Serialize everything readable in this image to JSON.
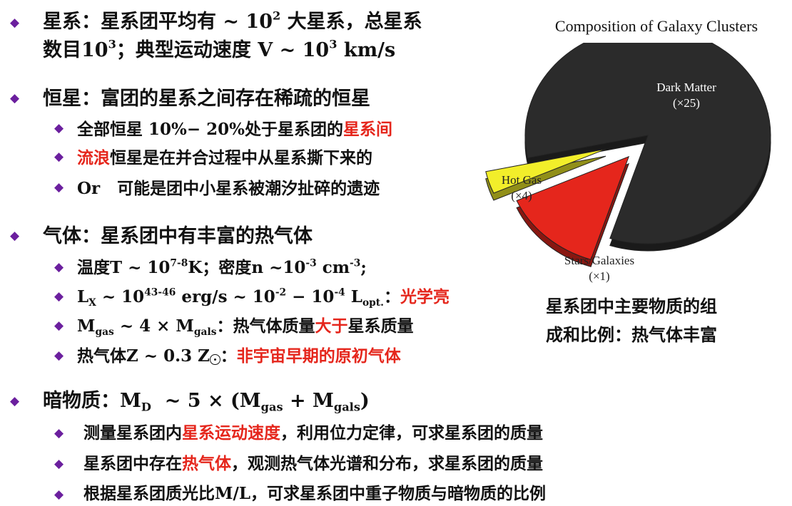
{
  "bullet_glyph": "◆",
  "s1": {
    "l1": {
      "a": "星系：星系团平均有 ~ 10",
      "sup": "2",
      "b": " 大星系，总星系"
    },
    "l2": {
      "a": "数目10",
      "sup": "3",
      "b": "；典型运动速度 V ~ 10",
      "sup2": "3",
      "c": " km/s"
    }
  },
  "s2": {
    "title": "恒星：富团的星系之间存在稀疏的恒星",
    "i1": {
      "a": "全部恒星 10%− 20%处于星系团的",
      "red": "星系间"
    },
    "i2": {
      "red": "流浪",
      "a": "恒星是在并合过程中从星系撕下来的"
    },
    "i3": {
      "a": "Or   可能是团中小星系被潮汐扯碎的遗迹"
    }
  },
  "s3": {
    "title": "气体：星系团中有丰富的热气体",
    "i1": {
      "a": "温度T ~ 10",
      "sup": "7-8",
      "b": "K；密度n ~10",
      "sup2": "-3",
      "c": " cm",
      "sup3": "-3",
      "d": ";"
    },
    "i2": {
      "a": "L",
      "sub": "X",
      "b": " ~ 10",
      "sup": "43-46",
      "c": " erg/s ~ 10",
      "sup2": "-2",
      "d": " − 10",
      "sup3": "-4",
      "e": " L",
      "sub2": "opt.",
      "f": "：",
      "red": "光学亮"
    },
    "i3": {
      "a": "M",
      "sub": "gas",
      "b": " ~ 4 × M",
      "sub2": "gals",
      "c": "：热气体质量",
      "red": "大于",
      "d": "星系质量"
    },
    "i4": {
      "a": "热气体Z ~ 0.3 Z",
      "b": "：",
      "red": "非宇宙早期的原初气体"
    }
  },
  "s4": {
    "title": {
      "a": "暗物质：M",
      "sub": "D",
      "b": "  ~ 5 × (M",
      "sub2": "gas",
      "c": " + M",
      "sub3": "gals",
      "d": ")"
    },
    "i1": {
      "a": "测量星系团内",
      "red": "星系运动速度",
      "b": "，利用位力定律，可求星系团的质量"
    },
    "i2": {
      "a": "星系团中存在",
      "red": "热气体",
      "b": "，观测热气体光谱和分布，求星系团的质量"
    },
    "i3": {
      "a": "根据星系团质光比M/L，可求星系团中重子物质与暗物质的比例"
    }
  },
  "chart_data": {
    "type": "pie",
    "title": "Composition of Galaxy Clusters",
    "slices": [
      {
        "label": "Dark Matter",
        "value_label": "(×25)",
        "value": 25,
        "color": "#2b2b2b"
      },
      {
        "label": "Hot Gas",
        "value_label": "(×4)",
        "value": 4,
        "color": "#e5261c"
      },
      {
        "label": "Stars/Galaxies",
        "value_label": "(×1)",
        "value": 1,
        "color": "#f2ee2a"
      }
    ],
    "exploded": [
      "Hot Gas",
      "Stars/Galaxies"
    ]
  },
  "caption": {
    "line1": "星系团中主要物质的组",
    "line2": "成和比例：热气体丰富"
  }
}
